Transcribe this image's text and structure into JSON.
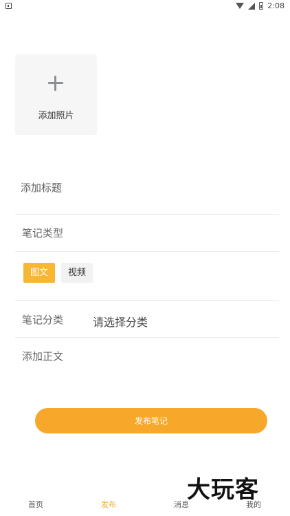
{
  "status_bar": {
    "time": "2:08"
  },
  "photo": {
    "label": "添加照片"
  },
  "title_field": {
    "placeholder": "添加标题"
  },
  "note_type": {
    "label": "笔记类型",
    "options": [
      {
        "label": "图文",
        "selected": true
      },
      {
        "label": "视频",
        "selected": false
      }
    ]
  },
  "category": {
    "label": "笔记分类",
    "value": "请选择分类"
  },
  "body_field": {
    "placeholder": "添加正文"
  },
  "publish_button": {
    "label": "发布笔记"
  },
  "bottom_nav": {
    "items": [
      {
        "label": "首页"
      },
      {
        "label": "发布",
        "active": true
      },
      {
        "label": "消息"
      },
      {
        "label": "我的"
      }
    ]
  },
  "watermark": {
    "text": "大玩客"
  },
  "colors": {
    "accent": "#f7b731",
    "button": "#f7a82b"
  }
}
